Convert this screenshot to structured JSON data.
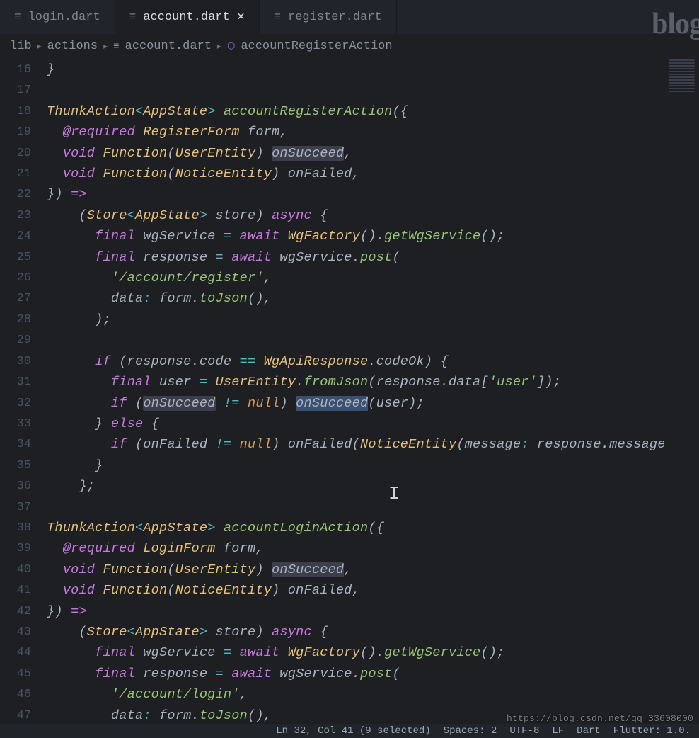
{
  "tabs": [
    {
      "label": "login.dart",
      "active": false
    },
    {
      "label": "account.dart",
      "active": true,
      "closable": true
    },
    {
      "label": "register.dart",
      "active": false
    }
  ],
  "watermark": "blog",
  "breadcrumbs": {
    "lib": "lib",
    "actions": "actions",
    "file": "account.dart",
    "symbol": "accountRegisterAction"
  },
  "lines": {
    "16": "16",
    "17": "17",
    "18": "18",
    "19": "19",
    "20": "20",
    "21": "21",
    "22": "22",
    "23": "23",
    "24": "24",
    "25": "25",
    "26": "26",
    "27": "27",
    "28": "28",
    "29": "29",
    "30": "30",
    "31": "31",
    "32": "32",
    "33": "33",
    "34": "34",
    "35": "35",
    "36": "36",
    "37": "37",
    "38": "38",
    "39": "39",
    "40": "40",
    "41": "41",
    "42": "42",
    "43": "43",
    "44": "44",
    "45": "45",
    "46": "46",
    "47": "47"
  },
  "code": {
    "l16": "}",
    "l18_ThunkAction": "ThunkAction",
    "l18_AppState": "AppState",
    "l18_fn": "accountRegisterAction",
    "l18_open": "({",
    "l19_at": "@required",
    "l19_type": "RegisterForm",
    "l19_rest": " form,",
    "l20_void": "void",
    "l20_Function": "Function",
    "l20_param": "UserEntity",
    "l20_name": "onSucceed",
    "l21_void": "void",
    "l21_Function": "Function",
    "l21_param": "NoticeEntity",
    "l21_name": "onFailed",
    "l22": "}) ",
    "l22_arrow": "=>",
    "l23_Store": "Store",
    "l23_AppState": "AppState",
    "l23_store": " store) ",
    "l23_async": "async",
    "l23_brace": " {",
    "l24_final": "final",
    "l24_a": " wgService ",
    "l24_eq": "=",
    "l24_await": "await",
    "l24_type": "WgFactory",
    "l24_call": "getWgService",
    "l25_final": "final",
    "l25_a": " response ",
    "l25_eq": "=",
    "l25_await": "await",
    "l25_rest": " wgService.",
    "l25_post": "post",
    "l26_str": "'/account/register'",
    "l27_a": "data",
    "l27_colon": ":",
    "l27_b": " form.",
    "l27_toJson": "toJson",
    "l27_end": "(),",
    "l28": ");",
    "l30_if": "if",
    "l30_a": " (response.code ",
    "l30_eq": "==",
    "l30_type": "WgApiResponse",
    "l30_b": ".codeOk) {",
    "l31_final": "final",
    "l31_a": " user ",
    "l31_eq": "=",
    "l31_type": "UserEntity",
    "l31_fromJson": "fromJson",
    "l31_b": "(response.data[",
    "l31_str": "'user'",
    "l31_c": "]);",
    "l32_if": "if",
    "l32_open": " (",
    "l32_on1": "onSucceed",
    "l32_neq": "!=",
    "l32_null": "null",
    "l32_close": ") ",
    "l32_on2": "onSucceed",
    "l32_end": "(user);",
    "l33_close": "} ",
    "l33_else": "else",
    "l33_open": " {",
    "l34_if": "if",
    "l34_a": " (onFailed ",
    "l34_neq": "!=",
    "l34_null": "null",
    "l34_b": ") onFailed(",
    "l34_type": "NoticeEntity",
    "l34_c": "(message",
    "l34_colon": ":",
    "l34_d": " response.message));",
    "l35": "}",
    "l36": "};",
    "l38_ThunkAction": "ThunkAction",
    "l38_AppState": "AppState",
    "l38_fn": "accountLoginAction",
    "l38_open": "({",
    "l39_at": "@required",
    "l39_type": "LoginForm",
    "l39_rest": " form,",
    "l40_void": "void",
    "l40_Function": "Function",
    "l40_param": "UserEntity",
    "l40_name": "onSucceed",
    "l41_void": "void",
    "l41_Function": "Function",
    "l41_param": "NoticeEntity",
    "l41_name": "onFailed",
    "l42": "}) ",
    "l42_arrow": "=>",
    "l43_Store": "Store",
    "l43_AppState": "AppState",
    "l43_store": " store) ",
    "l43_async": "async",
    "l43_brace": " {",
    "l44_final": "final",
    "l44_a": " wgService ",
    "l44_eq": "=",
    "l44_await": "await",
    "l44_type": "WgFactory",
    "l44_call": "getWgService",
    "l45_final": "final",
    "l45_a": " response ",
    "l45_eq": "=",
    "l45_await": "await",
    "l45_rest": " wgService.",
    "l45_post": "post",
    "l46_str": "'/account/login'",
    "l47_a": "data",
    "l47_colon": ":",
    "l47_b": " form.",
    "l47_toJson": "toJson",
    "l47_end": "(),"
  },
  "status": {
    "pos": "Ln 32, Col 41 (9 selected)",
    "spaces": "Spaces: 2",
    "encoding": "UTF-8",
    "eol": "LF",
    "lang": "Dart",
    "flutter": "Flutter: 1.0."
  },
  "overlay_url": "https://blog.csdn.net/qq_33608000"
}
